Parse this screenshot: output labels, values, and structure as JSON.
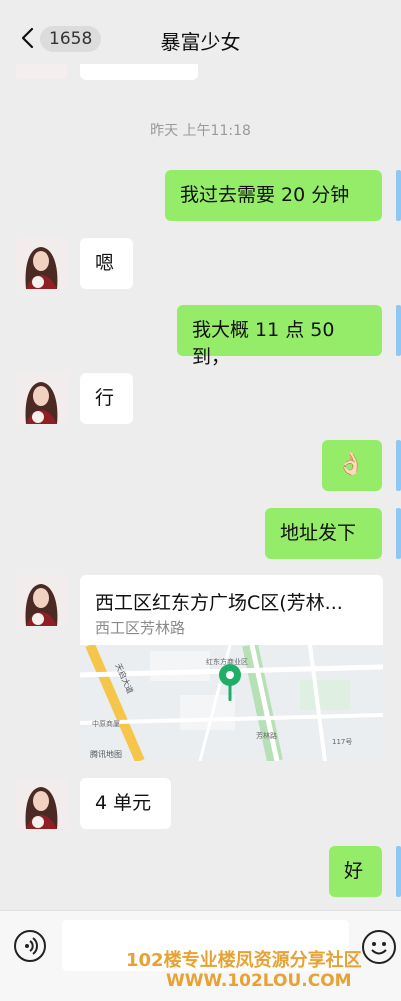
{
  "header": {
    "unread_count": "1658",
    "title": "暴富少女"
  },
  "timestamp": "昨天 上午11:18",
  "messages": [
    {
      "side": "out",
      "text": "我过去需要 20 分钟"
    },
    {
      "side": "in",
      "text": "嗯"
    },
    {
      "side": "out",
      "text": "我大概 11 点 50 到，"
    },
    {
      "side": "in",
      "text": "行"
    },
    {
      "side": "out",
      "text": "👌🏻"
    },
    {
      "side": "out",
      "text": "地址发下"
    },
    {
      "side": "in",
      "type": "location"
    },
    {
      "side": "in",
      "text": "4 单元"
    },
    {
      "side": "out",
      "text": "好"
    }
  ],
  "location": {
    "name": "西工区红东方广场C区(芳林...",
    "address": "西工区芳林路",
    "map_labels": [
      "天启大道",
      "红东方商业区",
      "芳林路",
      "腾讯地图",
      "中原商厦",
      "117号"
    ]
  },
  "watermark": {
    "line1": "102楼专业楼凤资源分享社区",
    "line2": "WWW.102LOU.COM"
  },
  "colors": {
    "out_bubble": "#95ec69",
    "in_bubble": "#ffffff",
    "map_pin": "#1fae68"
  }
}
